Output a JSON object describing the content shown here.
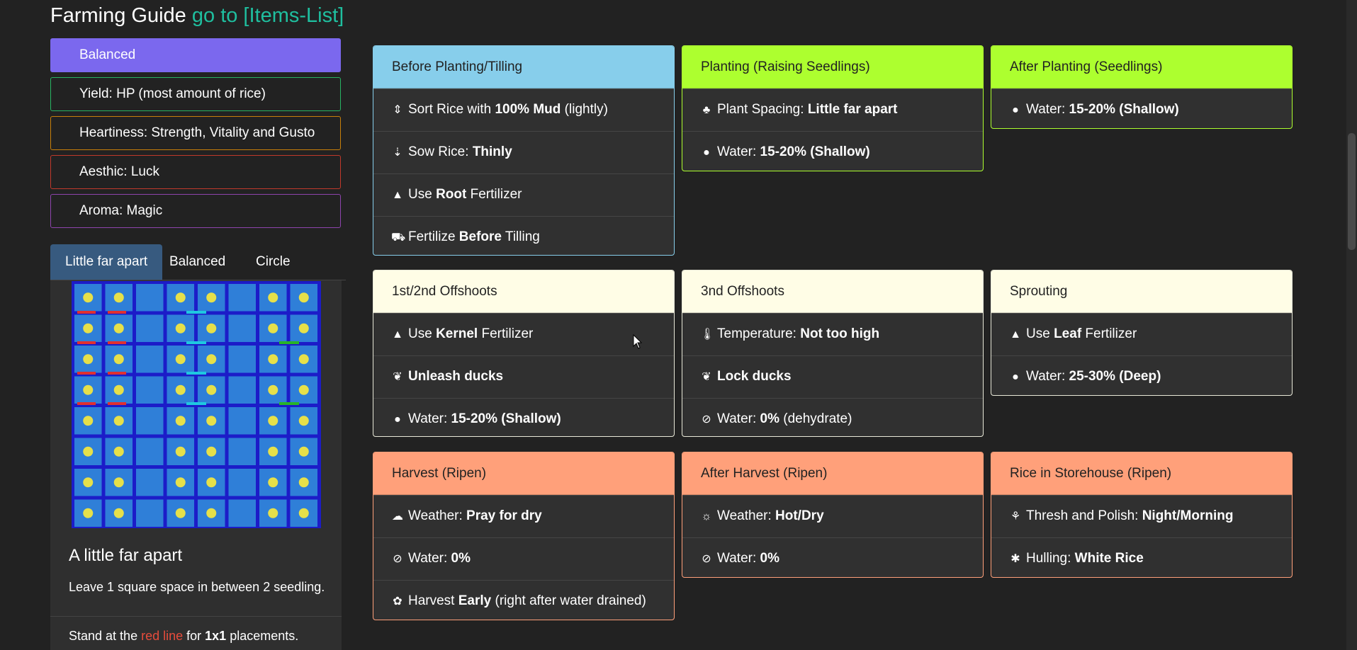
{
  "header": {
    "title": "Farming Guide",
    "link": "go to [Items-List]"
  },
  "options": [
    {
      "label": "Balanced",
      "border": "#7b68ee",
      "bg": "#7b68ee"
    },
    {
      "label": "Yield: HP (most amount of rice)",
      "border": "#28b463",
      "bg": "transparent"
    },
    {
      "label": "Heartiness: Strength, Vitality and Gusto",
      "border": "#c87f0a",
      "bg": "transparent"
    },
    {
      "label": "Aesthic: Luck",
      "border": "#c0392b",
      "bg": "transparent"
    },
    {
      "label": "Aroma: Magic",
      "border": "#8e44ad",
      "bg": "transparent"
    }
  ],
  "tabs": [
    "Little far apart",
    "Balanced",
    "Circle"
  ],
  "layout_panel": {
    "title": "A little far apart",
    "description": "Leave 1 square space in between 2 seedling.",
    "stand_prefix": "Stand at the ",
    "stand_red": "red line",
    "stand_mid": " for ",
    "stand_bold": "1x1",
    "stand_suffix": " placements."
  },
  "colors": {
    "grid_fill": "#2f7fd8",
    "grid_line": "#1c1cc8",
    "seed": "#e6e04a",
    "red_line": "#e03030",
    "cyan_line": "#1fc8e0",
    "green_line": "#28b428"
  },
  "cards": [
    {
      "title": "Before Planting/Tilling",
      "hdr_bg": "#87ceeb",
      "border": "#87ceeb",
      "rows": [
        {
          "icon": "sort-icon",
          "glyph": "⇕",
          "parts": [
            [
              "Sort Rice with ",
              false
            ],
            [
              "100% Mud",
              true
            ],
            [
              " (lightly)",
              false
            ]
          ]
        },
        {
          "icon": "sort-amount-icon",
          "glyph": "⇣",
          "parts": [
            [
              "Sow Rice: ",
              false
            ],
            [
              "Thinly",
              true
            ]
          ]
        },
        {
          "icon": "poop-icon",
          "glyph": "▲",
          "parts": [
            [
              "Use ",
              false
            ],
            [
              "Root",
              true
            ],
            [
              " Fertilizer",
              false
            ]
          ]
        },
        {
          "icon": "tractor-icon",
          "glyph": "⛟",
          "parts": [
            [
              "Fertilize ",
              false
            ],
            [
              "Before",
              true
            ],
            [
              " Tilling",
              false
            ]
          ]
        }
      ]
    },
    {
      "title": "Planting (Raising Seedlings)",
      "hdr_bg": "#adff2f",
      "border": "#adff2f",
      "rows": [
        {
          "icon": "seedling-icon",
          "glyph": "♣",
          "parts": [
            [
              "Plant Spacing: ",
              false
            ],
            [
              "Little far apart",
              true
            ]
          ]
        },
        {
          "icon": "water-drop-icon",
          "glyph": "●",
          "parts": [
            [
              "Water: ",
              false
            ],
            [
              "15-20% (Shallow)",
              true
            ]
          ]
        }
      ]
    },
    {
      "title": "After Planting (Seedlings)",
      "hdr_bg": "#adff2f",
      "border": "#adff2f",
      "rows": [
        {
          "icon": "water-drop-icon",
          "glyph": "●",
          "parts": [
            [
              "Water: ",
              false
            ],
            [
              "15-20% (Shallow)",
              true
            ]
          ]
        }
      ]
    },
    {
      "title": "1st/2nd Offshoots",
      "hdr_bg": "#fffde6",
      "border": "#e8e8d8",
      "rows": [
        {
          "icon": "poop-icon",
          "glyph": "▲",
          "parts": [
            [
              "Use ",
              false
            ],
            [
              "Kernel",
              true
            ],
            [
              " Fertilizer",
              false
            ]
          ]
        },
        {
          "icon": "feather-icon",
          "glyph": "❦",
          "parts": [
            [
              "Unleash ducks",
              true
            ]
          ]
        },
        {
          "icon": "water-drop-icon",
          "glyph": "●",
          "parts": [
            [
              "Water: ",
              false
            ],
            [
              "15-20% (Shallow)",
              true
            ]
          ]
        }
      ]
    },
    {
      "title": "3nd Offshoots",
      "hdr_bg": "#fffde6",
      "border": "#e8e8d8",
      "rows": [
        {
          "icon": "thermometer-icon",
          "glyph": "🌡",
          "parts": [
            [
              "Temperature: ",
              false
            ],
            [
              "Not too high",
              true
            ]
          ]
        },
        {
          "icon": "feather-icon",
          "glyph": "❦",
          "parts": [
            [
              "Lock ducks",
              true
            ]
          ]
        },
        {
          "icon": "no-water-icon",
          "glyph": "⊘",
          "parts": [
            [
              "Water: ",
              false
            ],
            [
              "0%",
              true
            ],
            [
              " (dehydrate)",
              false
            ]
          ]
        }
      ]
    },
    {
      "title": "Sprouting",
      "hdr_bg": "#fffde6",
      "border": "#e8e8d8",
      "rows": [
        {
          "icon": "poop-icon",
          "glyph": "▲",
          "parts": [
            [
              "Use ",
              false
            ],
            [
              "Leaf",
              true
            ],
            [
              " Fertilizer",
              false
            ]
          ]
        },
        {
          "icon": "water-drop-icon",
          "glyph": "●",
          "parts": [
            [
              "Water: ",
              false
            ],
            [
              "25-30% (Deep)",
              true
            ]
          ]
        }
      ]
    },
    {
      "title": "Harvest (Ripen)",
      "hdr_bg": "#ffa07a",
      "border": "#ffa07a",
      "rows": [
        {
          "icon": "cloud-sun-icon",
          "glyph": "☁",
          "parts": [
            [
              "Weather: ",
              false
            ],
            [
              "Pray for dry",
              true
            ]
          ]
        },
        {
          "icon": "no-water-icon",
          "glyph": "⊘",
          "parts": [
            [
              "Water: ",
              false
            ],
            [
              "0%",
              true
            ]
          ]
        },
        {
          "icon": "hand-seedling-icon",
          "glyph": "✿",
          "parts": [
            [
              "Harvest ",
              false
            ],
            [
              "Early",
              true
            ],
            [
              " (right after water drained)",
              false
            ]
          ]
        }
      ]
    },
    {
      "title": "After Harvest (Ripen)",
      "hdr_bg": "#ffa07a",
      "border": "#ffa07a",
      "rows": [
        {
          "icon": "sun-icon",
          "glyph": "☼",
          "parts": [
            [
              "Weather: ",
              false
            ],
            [
              "Hot/Dry",
              true
            ]
          ]
        },
        {
          "icon": "no-water-icon",
          "glyph": "⊘",
          "parts": [
            [
              "Water: ",
              false
            ],
            [
              "0%",
              true
            ]
          ]
        }
      ]
    },
    {
      "title": "Rice in Storehouse (Ripen)",
      "hdr_bg": "#ffa07a",
      "border": "#ffa07a",
      "rows": [
        {
          "icon": "wheat-icon",
          "glyph": "⚘",
          "parts": [
            [
              "Thresh and Polish: ",
              false
            ],
            [
              "Night/Morning",
              true
            ]
          ]
        },
        {
          "icon": "dharmachakra-icon",
          "glyph": "✱",
          "parts": [
            [
              "Hulling: ",
              false
            ],
            [
              "White Rice",
              true
            ]
          ]
        }
      ]
    }
  ]
}
